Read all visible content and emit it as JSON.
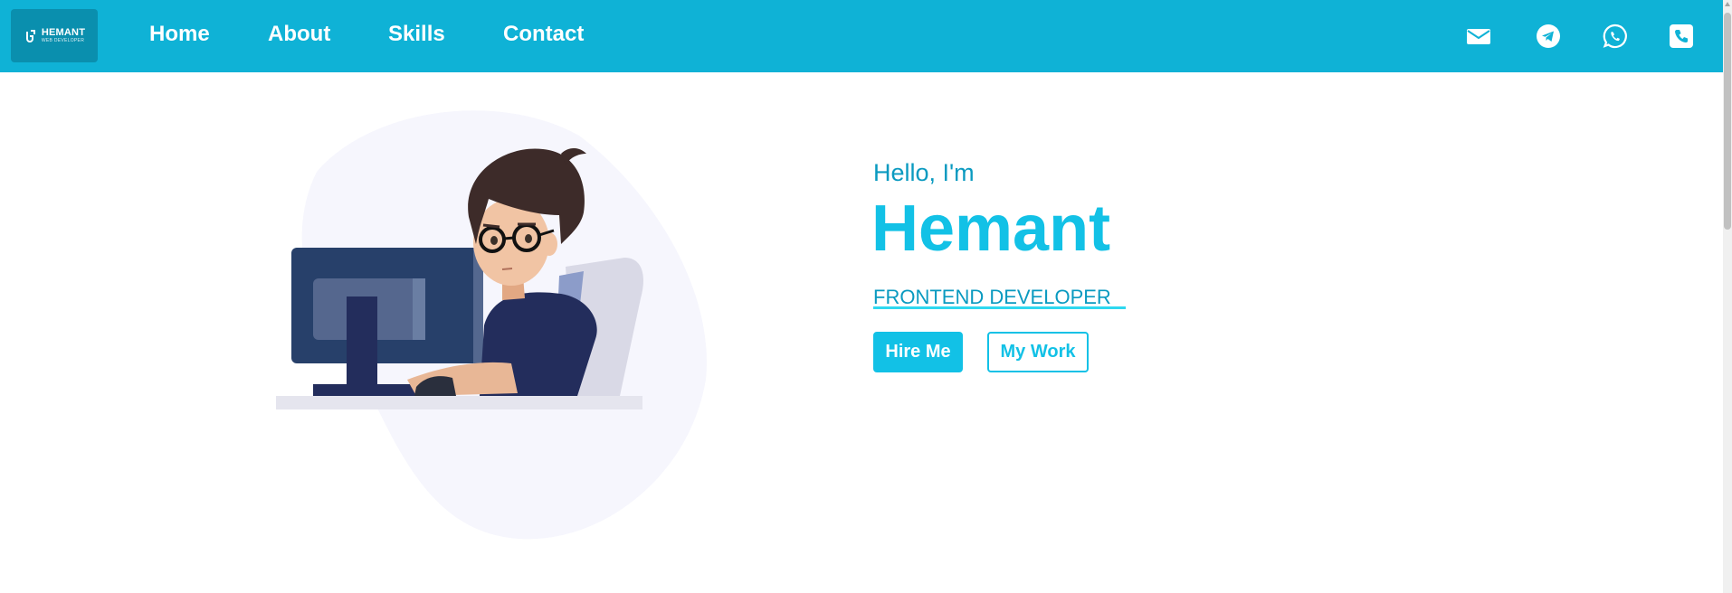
{
  "brand": {
    "name": "HEMANT",
    "tagline": "WEB DEVELOPER"
  },
  "nav": {
    "links": [
      {
        "label": "Home"
      },
      {
        "label": "About"
      },
      {
        "label": "Skills"
      },
      {
        "label": "Contact"
      }
    ],
    "icons": [
      "mail-icon",
      "telegram-icon",
      "whatsapp-icon",
      "phone-icon"
    ]
  },
  "hero": {
    "greeting": "Hello, I'm",
    "name": "Hemant",
    "role": "FRONTEND DEVELOPER",
    "buttons": {
      "hire": "Hire Me",
      "work": "My Work"
    }
  },
  "colors": {
    "navbar": "#0fb2d6",
    "accent": "#12c1e6",
    "text_accent": "#0a9ac0"
  }
}
